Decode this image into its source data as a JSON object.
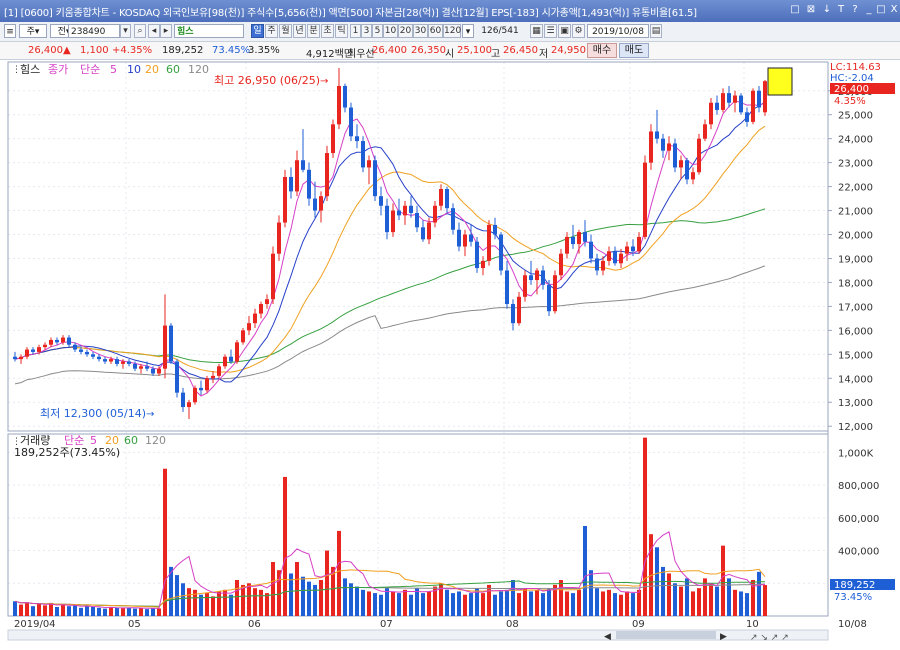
{
  "window": {
    "title": "[0600] 키움종합차트 - KOSDAQ 외국인보유[98(천)] 주식수[5,656(천)] 액면[500] 자본금[28(억)] 결산[12월] EPS[-183] 시가총액[1,493(억)] 유통비율[61.5]",
    "title_icon": "[1]",
    "controls": [
      "□",
      "⊠",
      "↓",
      "T",
      "?",
      "_",
      "□",
      "X"
    ]
  },
  "toolbar": {
    "period_label": "주",
    "market_label": "전",
    "code": "238490",
    "stock_name": "힘스",
    "selected_period": "일",
    "periods": [
      "일",
      "주",
      "월",
      "년",
      "분",
      "초",
      "틱"
    ],
    "minutes": [
      "1",
      "3",
      "5",
      "10",
      "20",
      "30",
      "60",
      "120"
    ],
    "count": "126",
    "total": "/541",
    "date": "2019/10/08"
  },
  "quote": {
    "price": "26,400",
    "change_arrow": "▲",
    "change": "1,100",
    "change_pct": "+4.35%",
    "volume": "189,252",
    "vol_ratio": "73.45%",
    "turnover": "3.35%",
    "trade_value": "4,912백만",
    "priority_label": "최우선",
    "ask": "26,400",
    "bid": "26,350",
    "open_label": "시",
    "open": "25,100",
    "high_label": "고",
    "high": "26,450",
    "low_label": "저",
    "low": "24,950",
    "buy_label": "매수",
    "sell_label": "매도"
  },
  "price_panel": {
    "stock_label": "힘스",
    "legend": {
      "close": "종가",
      "type": "단순",
      "ma": [
        "5",
        "10",
        "20",
        "60",
        "120"
      ]
    },
    "max_annotation": "최고 26,950 (06/25)",
    "min_annotation": "최저 12,300 (05/14)",
    "lc_label": "LC:114.63",
    "hc_label": "HC:-2.04",
    "current_price": "26,400",
    "current_pct": "4.35%",
    "y_ticks": [
      "26,000",
      "25,000",
      "24,000",
      "23,000",
      "22,000",
      "21,000",
      "20,000",
      "19,000",
      "18,000",
      "17,000",
      "16,000",
      "15,000",
      "14,000",
      "13,000",
      "12,000"
    ]
  },
  "volume_panel": {
    "legend": {
      "name": "거래량",
      "type": "단순",
      "ma": [
        "5",
        "20",
        "60",
        "120"
      ]
    },
    "current_text": "189,252주(73.45%)",
    "current_value": "189,252",
    "current_pct": "73.45%",
    "y_ticks": [
      "1,000K",
      "800,000",
      "600,000",
      "400,000",
      "200,000"
    ]
  },
  "x_axis": {
    "labels": [
      "2019/04",
      "05",
      "06",
      "07",
      "08",
      "09",
      "10",
      "10/08"
    ]
  },
  "colors": {
    "up": "#e8261f",
    "down": "#1e5fd6",
    "ma5": "#d63fc6",
    "ma10": "#2740c9",
    "ma20": "#f0a020",
    "ma60": "#36a040",
    "ma120": "#8a8a8a",
    "title_bg": "#5778c4"
  },
  "chart_data": {
    "type": "candlestick",
    "price": {
      "ylim": [
        11800,
        27200
      ],
      "candles": [
        [
          14900,
          15100,
          14700,
          14800
        ],
        [
          14800,
          15000,
          14600,
          14900
        ],
        [
          14900,
          15300,
          14800,
          15200
        ],
        [
          15200,
          15300,
          15000,
          15100
        ],
        [
          15100,
          15400,
          15000,
          15300
        ],
        [
          15300,
          15500,
          15200,
          15400
        ],
        [
          15400,
          15700,
          15300,
          15600
        ],
        [
          15600,
          15700,
          15400,
          15500
        ],
        [
          15500,
          15800,
          15400,
          15700
        ],
        [
          15700,
          15800,
          15300,
          15400
        ],
        [
          15400,
          15500,
          15100,
          15200
        ],
        [
          15200,
          15300,
          15000,
          15100
        ],
        [
          15100,
          15200,
          14900,
          15000
        ],
        [
          15000,
          15100,
          14800,
          14900
        ],
        [
          14900,
          15000,
          14700,
          14800
        ],
        [
          14800,
          14900,
          14600,
          14700
        ],
        [
          14700,
          14900,
          14600,
          14800
        ],
        [
          14800,
          14900,
          14500,
          14600
        ],
        [
          14600,
          14800,
          14400,
          14700
        ],
        [
          14700,
          14800,
          14500,
          14600
        ],
        [
          14600,
          14700,
          14300,
          14400
        ],
        [
          14400,
          14600,
          14200,
          14500
        ],
        [
          14500,
          14700,
          14300,
          14400
        ],
        [
          14400,
          14500,
          14100,
          14200
        ],
        [
          14200,
          14500,
          14100,
          14400
        ],
        [
          14400,
          17500,
          14000,
          16200
        ],
        [
          16200,
          16300,
          14600,
          14700
        ],
        [
          14700,
          14800,
          13200,
          13400
        ],
        [
          13400,
          13600,
          12600,
          12800
        ],
        [
          12800,
          13100,
          12300,
          13000
        ],
        [
          13000,
          13700,
          12900,
          13600
        ],
        [
          13600,
          13900,
          13300,
          13500
        ],
        [
          13500,
          14100,
          13400,
          14000
        ],
        [
          14000,
          14300,
          13800,
          14100
        ],
        [
          14100,
          14600,
          14000,
          14500
        ],
        [
          14500,
          15000,
          14400,
          14900
        ],
        [
          14900,
          15200,
          14600,
          14700
        ],
        [
          14700,
          15600,
          14600,
          15500
        ],
        [
          15500,
          16100,
          15400,
          16000
        ],
        [
          16000,
          16600,
          15800,
          16300
        ],
        [
          16300,
          16900,
          16100,
          16700
        ],
        [
          16700,
          17200,
          16500,
          17100
        ],
        [
          17100,
          17500,
          16900,
          17300
        ],
        [
          17300,
          19500,
          17100,
          19200
        ],
        [
          19200,
          20800,
          18900,
          20500
        ],
        [
          20500,
          22700,
          20300,
          22400
        ],
        [
          22400,
          22800,
          21500,
          21800
        ],
        [
          21800,
          23500,
          21600,
          23100
        ],
        [
          23100,
          24400,
          22600,
          22700
        ],
        [
          22700,
          23000,
          21200,
          21500
        ],
        [
          21500,
          22200,
          20700,
          21000
        ],
        [
          21000,
          21800,
          20500,
          21600
        ],
        [
          21600,
          23700,
          21400,
          23400
        ],
        [
          23400,
          24800,
          23200,
          24600
        ],
        [
          24600,
          26950,
          24400,
          26200
        ],
        [
          26200,
          26300,
          25100,
          25300
        ],
        [
          25300,
          25500,
          23900,
          24100
        ],
        [
          24100,
          24600,
          23600,
          23900
        ],
        [
          23900,
          24100,
          22600,
          22800
        ],
        [
          22800,
          23300,
          22100,
          23100
        ],
        [
          23100,
          23300,
          21400,
          21600
        ],
        [
          21600,
          22000,
          20800,
          21200
        ],
        [
          21200,
          21500,
          19800,
          20100
        ],
        [
          20100,
          21300,
          19900,
          21000
        ],
        [
          21000,
          21500,
          20600,
          20800
        ],
        [
          20800,
          21400,
          20400,
          21200
        ],
        [
          21200,
          21600,
          20700,
          20900
        ],
        [
          20900,
          21200,
          20100,
          20300
        ],
        [
          20300,
          20600,
          19700,
          19800
        ],
        [
          19800,
          20700,
          19600,
          20500
        ],
        [
          20500,
          21400,
          20300,
          21200
        ],
        [
          21200,
          22100,
          21000,
          21900
        ],
        [
          21900,
          22000,
          20900,
          21100
        ],
        [
          21100,
          21300,
          20000,
          20200
        ],
        [
          20200,
          20500,
          19300,
          19500
        ],
        [
          19500,
          20200,
          19100,
          20000
        ],
        [
          20000,
          20400,
          19500,
          19700
        ],
        [
          19700,
          19900,
          18400,
          18600
        ],
        [
          18600,
          19100,
          18300,
          18900
        ],
        [
          18900,
          20600,
          18700,
          20400
        ],
        [
          20400,
          20700,
          19800,
          20000
        ],
        [
          20000,
          20100,
          18300,
          18500
        ],
        [
          18500,
          18900,
          16900,
          17100
        ],
        [
          17100,
          17300,
          16000,
          16300
        ],
        [
          16300,
          17600,
          16200,
          17400
        ],
        [
          17400,
          18500,
          17200,
          18300
        ],
        [
          18300,
          18900,
          17900,
          18100
        ],
        [
          18100,
          18600,
          17500,
          18500
        ],
        [
          18500,
          18700,
          17700,
          17900
        ],
        [
          17900,
          18100,
          16600,
          16800
        ],
        [
          16800,
          18500,
          16700,
          18300
        ],
        [
          18300,
          19400,
          18100,
          19200
        ],
        [
          19200,
          20100,
          19000,
          19900
        ],
        [
          19900,
          20400,
          19400,
          19600
        ],
        [
          19600,
          20200,
          19200,
          20100
        ],
        [
          20100,
          20600,
          19500,
          19700
        ],
        [
          19700,
          20000,
          18800,
          19000
        ],
        [
          19000,
          19200,
          18300,
          18500
        ],
        [
          18500,
          19100,
          18300,
          18900
        ],
        [
          18900,
          19500,
          18700,
          19300
        ],
        [
          19300,
          19500,
          18700,
          18800
        ],
        [
          18800,
          19400,
          18600,
          19200
        ],
        [
          19200,
          19700,
          18900,
          19500
        ],
        [
          19500,
          19800,
          19100,
          19300
        ],
        [
          19300,
          20100,
          19200,
          19900
        ],
        [
          19900,
          23300,
          19800,
          23000
        ],
        [
          23000,
          24600,
          22700,
          24300
        ],
        [
          24300,
          25200,
          23800,
          24000
        ],
        [
          24000,
          24200,
          23200,
          23500
        ],
        [
          23500,
          24100,
          23100,
          23800
        ],
        [
          23800,
          24000,
          22600,
          22800
        ],
        [
          22800,
          23300,
          22300,
          23100
        ],
        [
          23100,
          23200,
          22100,
          22300
        ],
        [
          22300,
          22800,
          22100,
          22600
        ],
        [
          22600,
          24200,
          22500,
          24000
        ],
        [
          24000,
          24800,
          23900,
          24600
        ],
        [
          24600,
          25700,
          24400,
          25500
        ],
        [
          25500,
          25800,
          25000,
          25200
        ],
        [
          25200,
          26100,
          25100,
          25900
        ],
        [
          25900,
          26200,
          25300,
          25500
        ],
        [
          25500,
          26000,
          25100,
          25800
        ],
        [
          25800,
          25900,
          25000,
          25100
        ],
        [
          25100,
          25300,
          24500,
          24700
        ],
        [
          24700,
          26100,
          24600,
          26000
        ],
        [
          26000,
          26200,
          25100,
          25300
        ],
        [
          25100,
          26450,
          24950,
          26400
        ]
      ]
    },
    "volume": {
      "ylim": [
        0,
        1100000
      ],
      "values": [
        90000,
        70000,
        85000,
        60000,
        75000,
        65000,
        80000,
        55000,
        70000,
        60000,
        65000,
        50000,
        60000,
        55000,
        50000,
        45000,
        55000,
        50000,
        48000,
        52000,
        45000,
        50000,
        42000,
        48000,
        46000,
        900000,
        300000,
        250000,
        200000,
        170000,
        160000,
        130000,
        140000,
        120000,
        150000,
        160000,
        130000,
        220000,
        190000,
        200000,
        170000,
        160000,
        140000,
        330000,
        280000,
        850000,
        260000,
        330000,
        240000,
        210000,
        190000,
        220000,
        400000,
        300000,
        520000,
        230000,
        200000,
        180000,
        160000,
        150000,
        140000,
        130000,
        170000,
        150000,
        140000,
        160000,
        130000,
        170000,
        140000,
        150000,
        180000,
        200000,
        160000,
        140000,
        150000,
        130000,
        140000,
        170000,
        140000,
        190000,
        130000,
        150000,
        160000,
        220000,
        140000,
        170000,
        150000,
        160000,
        140000,
        170000,
        190000,
        220000,
        150000,
        140000,
        160000,
        550000,
        280000,
        170000,
        150000,
        160000,
        140000,
        130000,
        150000,
        140000,
        160000,
        1090000,
        500000,
        420000,
        300000,
        260000,
        200000,
        180000,
        230000,
        150000,
        170000,
        230000,
        200000,
        180000,
        430000,
        230000,
        160000,
        150000,
        140000,
        220000,
        270000,
        189252
      ]
    },
    "x_labels": [
      "2019/04",
      "05",
      "06",
      "07",
      "08",
      "09",
      "10"
    ]
  }
}
